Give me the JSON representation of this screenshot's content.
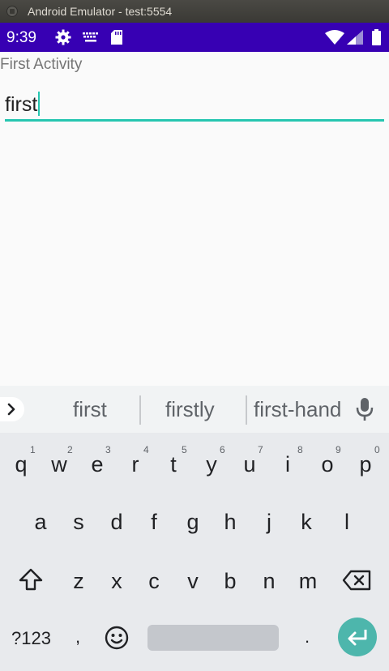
{
  "window": {
    "title": "Android Emulator - test:5554"
  },
  "status_bar": {
    "time": "9:39",
    "background": "#3700b3"
  },
  "app": {
    "label": "First Activity"
  },
  "text_field": {
    "value": "first",
    "accent": "#26c6b0"
  },
  "keyboard": {
    "suggestions": [
      "first",
      "firstly",
      "first-hand"
    ],
    "row1": [
      "q",
      "w",
      "e",
      "r",
      "t",
      "y",
      "u",
      "i",
      "o",
      "p"
    ],
    "row1_hints": [
      "1",
      "2",
      "3",
      "4",
      "5",
      "6",
      "7",
      "8",
      "9",
      "0"
    ],
    "row2": [
      "a",
      "s",
      "d",
      "f",
      "g",
      "h",
      "j",
      "k",
      "l"
    ],
    "row3": [
      "z",
      "x",
      "c",
      "v",
      "b",
      "n",
      "m"
    ],
    "symbols_label": "?123",
    "comma": ",",
    "period": ".",
    "enter_color": "#4db6ac"
  }
}
